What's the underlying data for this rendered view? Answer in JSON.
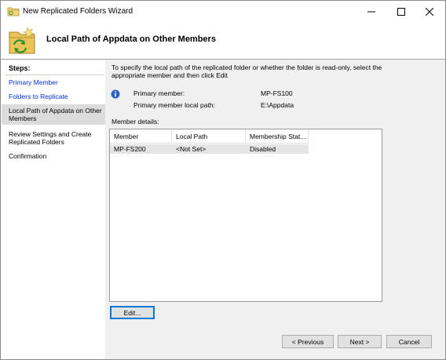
{
  "window": {
    "title": "New Replicated Folders Wizard",
    "controls": {
      "minimize": "minimize",
      "maximize": "maximize",
      "close": "close"
    }
  },
  "header": {
    "title": "Local Path of Appdata on Other Members",
    "icon": "replicated-folder-icon"
  },
  "steps": {
    "title": "Steps:",
    "items": [
      {
        "label": "Primary Member",
        "state": "link"
      },
      {
        "label": "Folders to Replicate",
        "state": "link"
      },
      {
        "label": "Local Path of Appdata on Other Members",
        "state": "current"
      },
      {
        "label": "Review Settings and Create Replicated Folders",
        "state": "plain"
      },
      {
        "label": "Confirmation",
        "state": "plain"
      }
    ]
  },
  "content": {
    "instructions": "To specify the local path of the replicated folder or whether the folder is read-only, select the appropriate member and then click Edit",
    "info_icon": "info-icon",
    "primary_member_label": "Primary member:",
    "primary_member_value": "MP-FS100",
    "primary_path_label": "Primary member local path:",
    "primary_path_value": "E:\\Appdata",
    "details_label": "Member details:",
    "table": {
      "columns": [
        "Member",
        "Local Path",
        "Membership Stat..."
      ],
      "rows": [
        {
          "member": "MP-FS200",
          "path": "<Not Set>",
          "status": "Disabled"
        }
      ]
    },
    "edit_button": "Edit..."
  },
  "footer": {
    "previous": "< Previous",
    "next": "Next >",
    "cancel": "Cancel"
  },
  "colors": {
    "link": "#0033cc",
    "content_bg": "#f0f0f0",
    "selected_row": "#e5e5e5",
    "focus_border": "#0078d7"
  }
}
